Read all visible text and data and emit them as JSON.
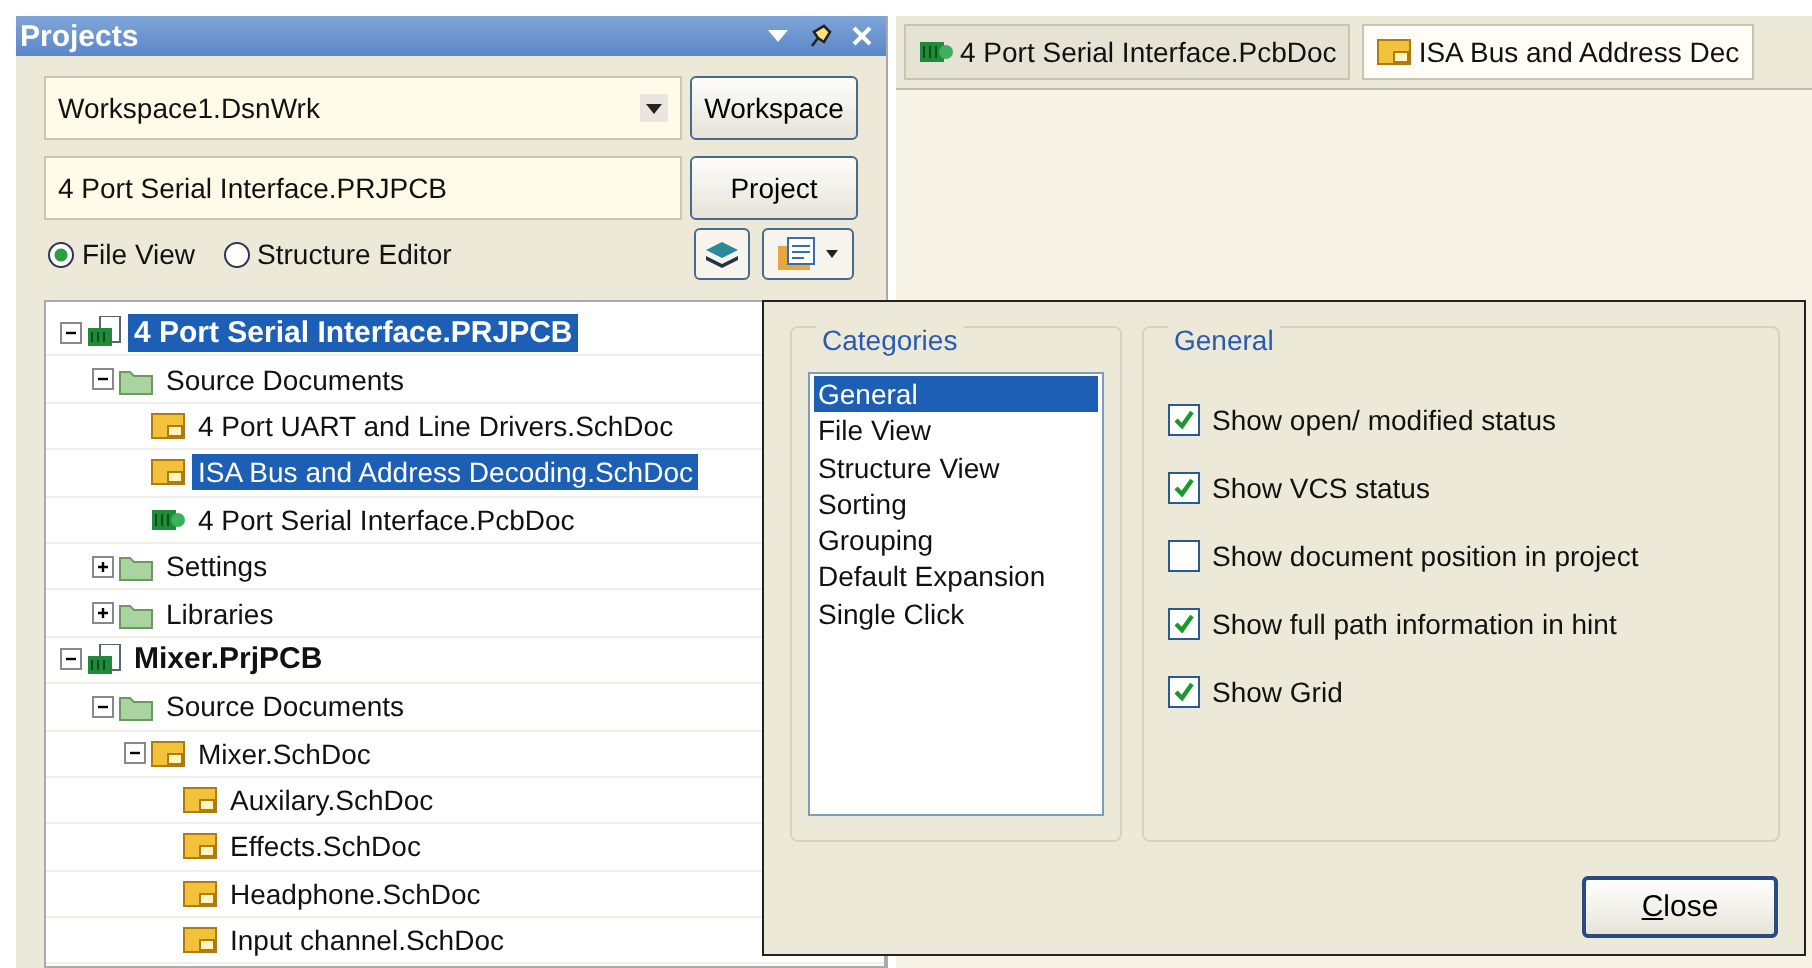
{
  "panel": {
    "title": "Projects",
    "workspace_field": {
      "value": "Workspace1.DsnWrk"
    },
    "workspace_button": "Workspace",
    "project_field": {
      "value": "4 Port Serial Interface.PRJPCB"
    },
    "project_button": "Project",
    "view_options": [
      {
        "label": "File View",
        "selected": true
      },
      {
        "label": "Structure Editor",
        "selected": false
      }
    ],
    "tree": [
      {
        "label": "4 Port Serial Interface.PRJPCB",
        "kind": "project",
        "selected": true,
        "expanded": true,
        "children": [
          {
            "label": "Source Documents",
            "kind": "folder",
            "selected": false,
            "expanded": true,
            "children": [
              {
                "label": "4 Port UART and Line Drivers.SchDoc",
                "kind": "schematic",
                "selected": false
              },
              {
                "label": "ISA Bus and Address Decoding.SchDoc",
                "kind": "schematic",
                "selected": true
              },
              {
                "label": "4 Port Serial Interface.PcbDoc",
                "kind": "pcb",
                "selected": false
              }
            ]
          },
          {
            "label": "Settings",
            "kind": "folder",
            "selected": false,
            "expanded": false
          },
          {
            "label": "Libraries",
            "kind": "folder",
            "selected": false,
            "expanded": false
          }
        ]
      },
      {
        "label": "Mixer.PrjPCB",
        "kind": "project",
        "selected": false,
        "expanded": true,
        "children": [
          {
            "label": "Source Documents",
            "kind": "folder",
            "selected": false,
            "expanded": true,
            "children": [
              {
                "label": "Mixer.SchDoc",
                "kind": "schematic",
                "selected": false,
                "expanded": true,
                "children": [
                  {
                    "label": "Auxilary.SchDoc",
                    "kind": "schematic",
                    "selected": false
                  },
                  {
                    "label": "Effects.SchDoc",
                    "kind": "schematic",
                    "selected": false
                  },
                  {
                    "label": "Headphone.SchDoc",
                    "kind": "schematic",
                    "selected": false
                  },
                  {
                    "label": "Input channel.SchDoc",
                    "kind": "schematic",
                    "selected": false
                  }
                ]
              }
            ]
          }
        ]
      }
    ]
  },
  "tabs": [
    {
      "label": "4 Port Serial Interface.PcbDoc",
      "kind": "pcb",
      "selected": false
    },
    {
      "label": "ISA Bus and Address Dec",
      "kind": "schematic",
      "selected": true
    }
  ],
  "dialog": {
    "categories_title": "Categories",
    "categories": [
      {
        "label": "General",
        "selected": true
      },
      {
        "label": "File View",
        "selected": false
      },
      {
        "label": "Structure View",
        "selected": false
      },
      {
        "label": "Sorting",
        "selected": false
      },
      {
        "label": "Grouping",
        "selected": false
      },
      {
        "label": "Default Expansion",
        "selected": false
      },
      {
        "label": "Single Click",
        "selected": false
      }
    ],
    "general_title": "General",
    "options": [
      {
        "label": "Show open/ modified status",
        "checked": true
      },
      {
        "label": "Show VCS status",
        "checked": true
      },
      {
        "label": "Show document position in project",
        "checked": false
      },
      {
        "label": "Show full path information in hint",
        "checked": true
      },
      {
        "label": "Show Grid",
        "checked": true
      }
    ],
    "close_button": "Close"
  }
}
